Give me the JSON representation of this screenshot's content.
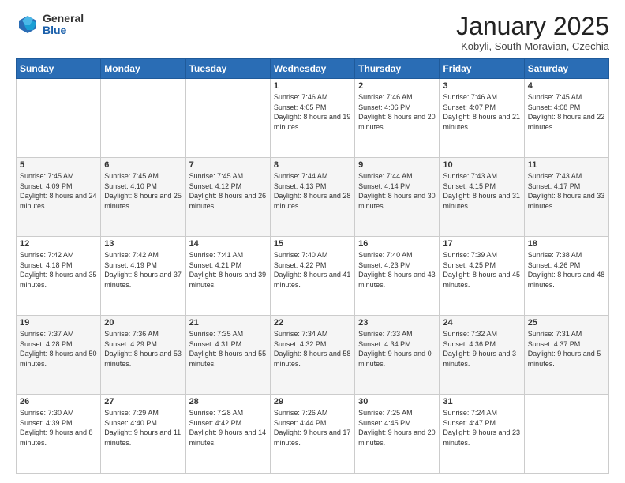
{
  "logo": {
    "general": "General",
    "blue": "Blue"
  },
  "header": {
    "month": "January 2025",
    "location": "Kobyli, South Moravian, Czechia"
  },
  "days_of_week": [
    "Sunday",
    "Monday",
    "Tuesday",
    "Wednesday",
    "Thursday",
    "Friday",
    "Saturday"
  ],
  "weeks": [
    [
      {
        "day": "",
        "info": ""
      },
      {
        "day": "",
        "info": ""
      },
      {
        "day": "",
        "info": ""
      },
      {
        "day": "1",
        "info": "Sunrise: 7:46 AM\nSunset: 4:05 PM\nDaylight: 8 hours and 19 minutes."
      },
      {
        "day": "2",
        "info": "Sunrise: 7:46 AM\nSunset: 4:06 PM\nDaylight: 8 hours and 20 minutes."
      },
      {
        "day": "3",
        "info": "Sunrise: 7:46 AM\nSunset: 4:07 PM\nDaylight: 8 hours and 21 minutes."
      },
      {
        "day": "4",
        "info": "Sunrise: 7:45 AM\nSunset: 4:08 PM\nDaylight: 8 hours and 22 minutes."
      }
    ],
    [
      {
        "day": "5",
        "info": "Sunrise: 7:45 AM\nSunset: 4:09 PM\nDaylight: 8 hours and 24 minutes."
      },
      {
        "day": "6",
        "info": "Sunrise: 7:45 AM\nSunset: 4:10 PM\nDaylight: 8 hours and 25 minutes."
      },
      {
        "day": "7",
        "info": "Sunrise: 7:45 AM\nSunset: 4:12 PM\nDaylight: 8 hours and 26 minutes."
      },
      {
        "day": "8",
        "info": "Sunrise: 7:44 AM\nSunset: 4:13 PM\nDaylight: 8 hours and 28 minutes."
      },
      {
        "day": "9",
        "info": "Sunrise: 7:44 AM\nSunset: 4:14 PM\nDaylight: 8 hours and 30 minutes."
      },
      {
        "day": "10",
        "info": "Sunrise: 7:43 AM\nSunset: 4:15 PM\nDaylight: 8 hours and 31 minutes."
      },
      {
        "day": "11",
        "info": "Sunrise: 7:43 AM\nSunset: 4:17 PM\nDaylight: 8 hours and 33 minutes."
      }
    ],
    [
      {
        "day": "12",
        "info": "Sunrise: 7:42 AM\nSunset: 4:18 PM\nDaylight: 8 hours and 35 minutes."
      },
      {
        "day": "13",
        "info": "Sunrise: 7:42 AM\nSunset: 4:19 PM\nDaylight: 8 hours and 37 minutes."
      },
      {
        "day": "14",
        "info": "Sunrise: 7:41 AM\nSunset: 4:21 PM\nDaylight: 8 hours and 39 minutes."
      },
      {
        "day": "15",
        "info": "Sunrise: 7:40 AM\nSunset: 4:22 PM\nDaylight: 8 hours and 41 minutes."
      },
      {
        "day": "16",
        "info": "Sunrise: 7:40 AM\nSunset: 4:23 PM\nDaylight: 8 hours and 43 minutes."
      },
      {
        "day": "17",
        "info": "Sunrise: 7:39 AM\nSunset: 4:25 PM\nDaylight: 8 hours and 45 minutes."
      },
      {
        "day": "18",
        "info": "Sunrise: 7:38 AM\nSunset: 4:26 PM\nDaylight: 8 hours and 48 minutes."
      }
    ],
    [
      {
        "day": "19",
        "info": "Sunrise: 7:37 AM\nSunset: 4:28 PM\nDaylight: 8 hours and 50 minutes."
      },
      {
        "day": "20",
        "info": "Sunrise: 7:36 AM\nSunset: 4:29 PM\nDaylight: 8 hours and 53 minutes."
      },
      {
        "day": "21",
        "info": "Sunrise: 7:35 AM\nSunset: 4:31 PM\nDaylight: 8 hours and 55 minutes."
      },
      {
        "day": "22",
        "info": "Sunrise: 7:34 AM\nSunset: 4:32 PM\nDaylight: 8 hours and 58 minutes."
      },
      {
        "day": "23",
        "info": "Sunrise: 7:33 AM\nSunset: 4:34 PM\nDaylight: 9 hours and 0 minutes."
      },
      {
        "day": "24",
        "info": "Sunrise: 7:32 AM\nSunset: 4:36 PM\nDaylight: 9 hours and 3 minutes."
      },
      {
        "day": "25",
        "info": "Sunrise: 7:31 AM\nSunset: 4:37 PM\nDaylight: 9 hours and 5 minutes."
      }
    ],
    [
      {
        "day": "26",
        "info": "Sunrise: 7:30 AM\nSunset: 4:39 PM\nDaylight: 9 hours and 8 minutes."
      },
      {
        "day": "27",
        "info": "Sunrise: 7:29 AM\nSunset: 4:40 PM\nDaylight: 9 hours and 11 minutes."
      },
      {
        "day": "28",
        "info": "Sunrise: 7:28 AM\nSunset: 4:42 PM\nDaylight: 9 hours and 14 minutes."
      },
      {
        "day": "29",
        "info": "Sunrise: 7:26 AM\nSunset: 4:44 PM\nDaylight: 9 hours and 17 minutes."
      },
      {
        "day": "30",
        "info": "Sunrise: 7:25 AM\nSunset: 4:45 PM\nDaylight: 9 hours and 20 minutes."
      },
      {
        "day": "31",
        "info": "Sunrise: 7:24 AM\nSunset: 4:47 PM\nDaylight: 9 hours and 23 minutes."
      },
      {
        "day": "",
        "info": ""
      }
    ]
  ]
}
